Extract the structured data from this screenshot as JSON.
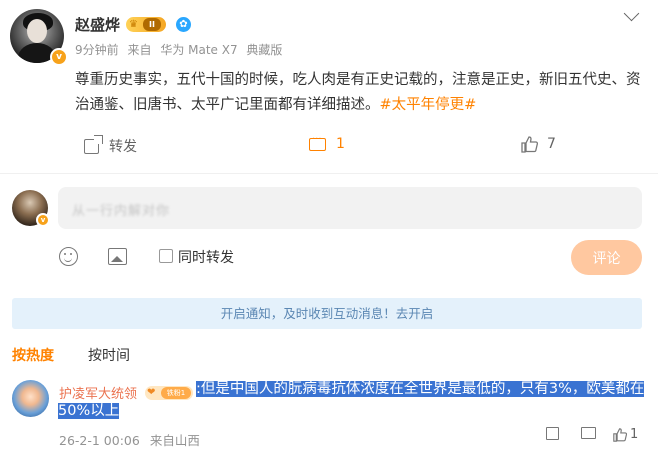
{
  "post": {
    "username": "赵盛烨",
    "level_badge": "II",
    "meta": {
      "time": "9分钟前",
      "source_prefix": "来自",
      "device": "华为 Mate X7",
      "device_edition": "典藏版"
    },
    "content": "尊重历史事实，五代十国的时候，吃人肉是有正史记载的，注意是正史，新旧五代史、资治通鉴、旧唐书、太平广记里面都有详细描述。",
    "hashtag": "#太平年停更#",
    "actions": {
      "repost_label": "转发",
      "comment_count": "1",
      "like_count": "7"
    }
  },
  "composer": {
    "placeholder_blurred": "从一行内解对你",
    "repost_checkbox_label": "同时转发",
    "submit_label": "评论"
  },
  "notice": {
    "text": "开启通知，及时收到互动消息！去开启"
  },
  "sort": {
    "hot_label": "按热度",
    "time_label": "按时间"
  },
  "comment": {
    "username": "护凌军大统领",
    "fan_badge": "铁粉1",
    "separator": ":",
    "text": "但是中国人的朊病毒抗体浓度在全世界是最低的，只有3%，欧美都在50%以上",
    "date": "26-2-1 00:06",
    "location": "来自山西",
    "like_count": "1"
  },
  "colors": {
    "accent_orange": "#ff8200",
    "selection_blue": "#3a73d2",
    "notice_bg": "#e4f1fb",
    "comment_name": "#eb7350"
  },
  "icons": [
    "more-chevron-icon",
    "verified-v-icon",
    "share-icon",
    "comment-icon",
    "like-icon",
    "emoji-icon",
    "image-icon"
  ]
}
